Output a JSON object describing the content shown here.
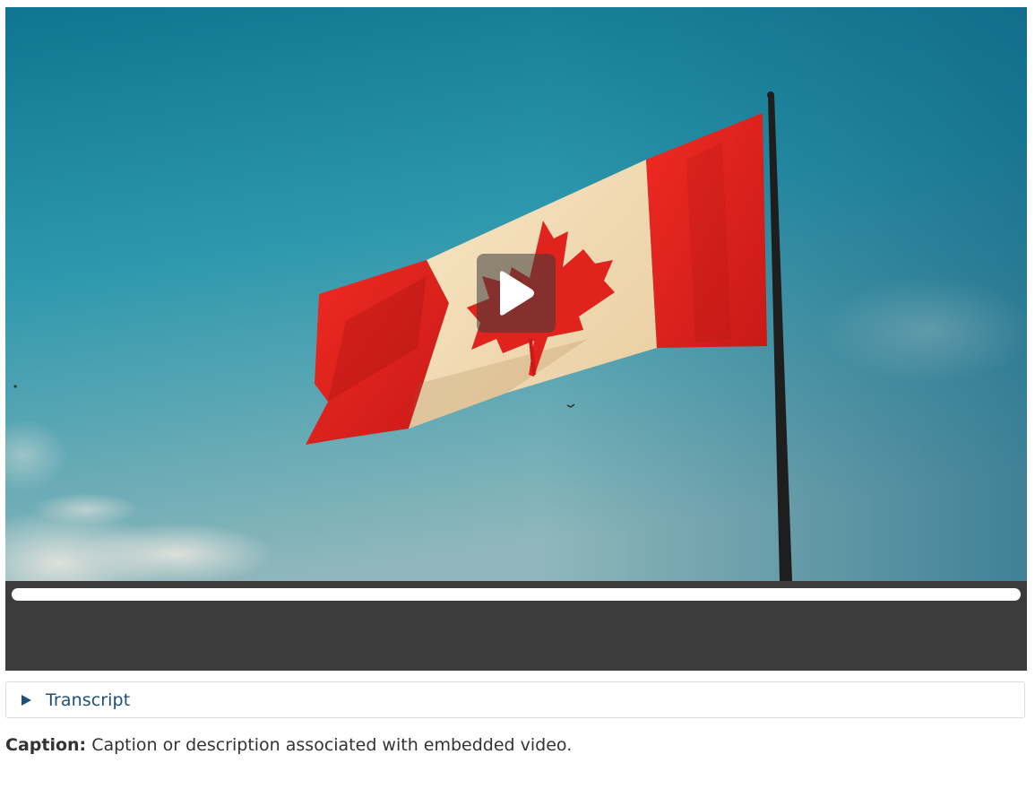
{
  "video": {
    "poster_description": "Canadian flag waving on a flagpole against a blue sky",
    "play_label": "Play",
    "progress": 0
  },
  "transcript": {
    "label": "Transcript",
    "icon": "disclosure-triangle-icon"
  },
  "caption": {
    "label": "Caption:",
    "text": "Caption or description associated with embedded video."
  },
  "colors": {
    "link": "#1d4f7a",
    "control_bar": "#3c3c3c",
    "flag_red": "#e0231c",
    "sky_top": "#0e7a95"
  }
}
